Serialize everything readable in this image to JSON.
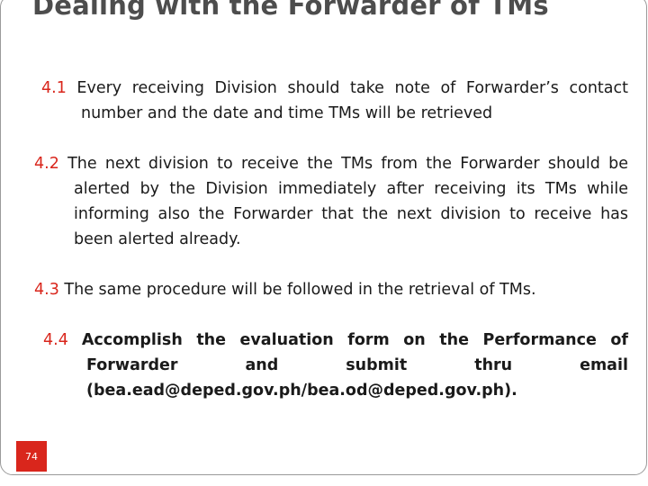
{
  "slide": {
    "title": "Dealing with the Forwarder of TMs",
    "accent_color": "#d9261c",
    "title_color": "#4d4d4d",
    "slide_number": "74",
    "items": [
      {
        "number": "4.1",
        "text": "Every receiving Division should take note of Forwarder’s contact number and the date and time TMs will be retrieved"
      },
      {
        "number": "4.2",
        "text": "The next division to receive the TMs from the Forwarder should be alerted by the Division immediately after receiving its TMs while informing also the Forwarder that the next division to receive has been alerted already."
      },
      {
        "number": "4.3",
        "text": "The same procedure will be followed in the retrieval of TMs."
      },
      {
        "number": "4.4",
        "text": "Accomplish the evaluation form on the Performance of Forwarder and submit thru email (bea.ead@deped.gov.ph/bea.od@deped.gov.ph)."
      }
    ]
  }
}
